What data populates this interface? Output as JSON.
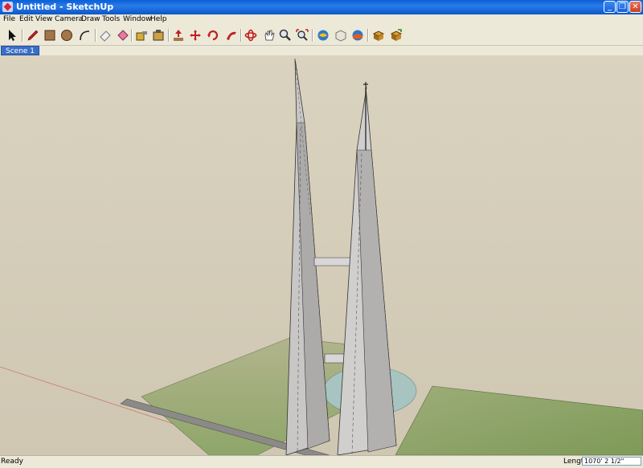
{
  "window": {
    "title": "Untitled - SketchUp",
    "minimize": "_",
    "maximize": "❐",
    "close": "✕"
  },
  "menu": [
    "File",
    "Edit",
    "View",
    "Camera",
    "Draw",
    "Tools",
    "Window",
    "Help"
  ],
  "toolbar": {
    "tools": [
      "select-icon",
      "pencil-icon",
      "rectangle-icon",
      "circle-icon",
      "arc-icon",
      "eraser-icon",
      "paint-bucket-icon",
      "tape-measure-icon",
      "paint-icon",
      "push-pull-icon",
      "move-icon",
      "rotate-icon",
      "follow-me-icon",
      "orbit-icon",
      "pan-icon",
      "zoom-icon",
      "zoom-extents-icon",
      "get-models-icon",
      "components-icon",
      "share-model-icon",
      "google-earth-icon",
      "materials-icon"
    ]
  },
  "scenes": [
    "Scene 1"
  ],
  "status": {
    "text": "Ready",
    "length_label": "Length",
    "length_value": "1070' 2 1/2\""
  }
}
